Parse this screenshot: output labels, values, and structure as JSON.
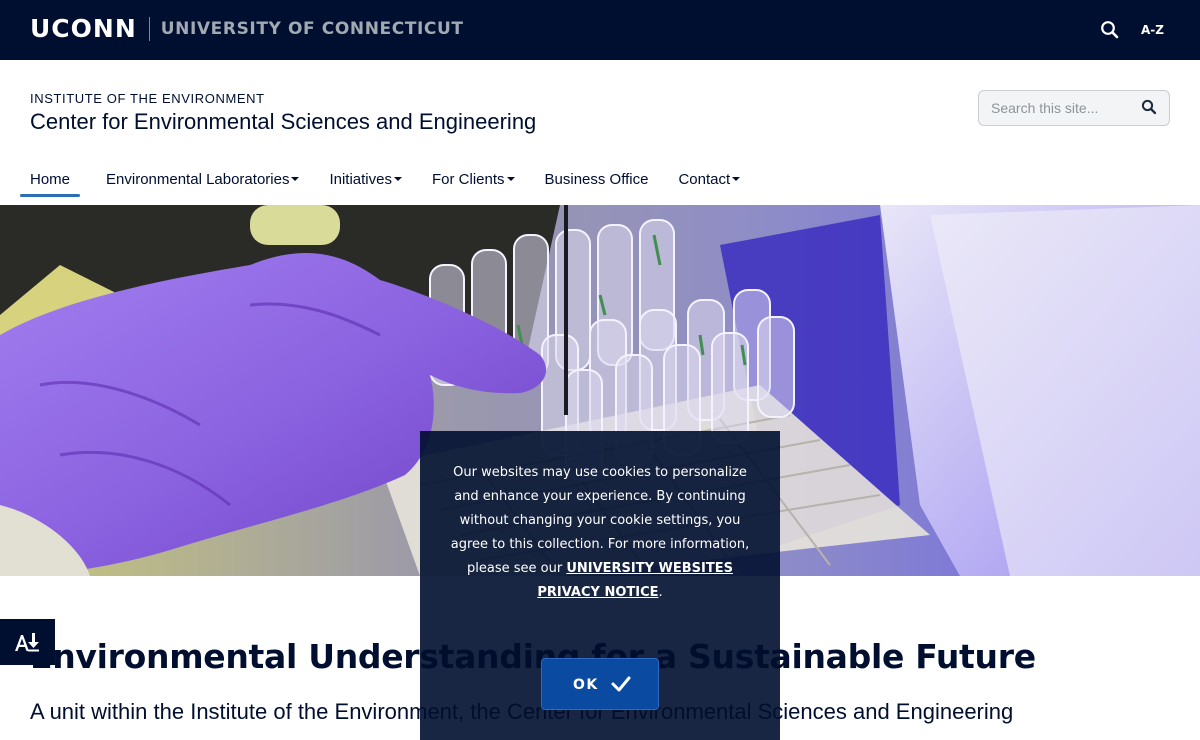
{
  "topbar": {
    "logo": "UCONN",
    "university": "UNIVERSITY OF CONNECTICUT",
    "search_icon": "search-icon",
    "az_label": "A-Z"
  },
  "header": {
    "institute": "INSTITUTE OF THE ENVIRONMENT",
    "title": "Center for Environmental Sciences and Engineering",
    "search_placeholder": "Search this site...",
    "search_icon": "search-icon"
  },
  "nav": {
    "items": [
      {
        "label": "Home",
        "active": true,
        "dropdown": false
      },
      {
        "label": "Environmental Laboratories",
        "active": false,
        "dropdown": true
      },
      {
        "label": "Initiatives",
        "active": false,
        "dropdown": true
      },
      {
        "label": "For Clients",
        "active": false,
        "dropdown": true
      },
      {
        "label": "Business Office",
        "active": false,
        "dropdown": false
      },
      {
        "label": "Contact",
        "active": false,
        "dropdown": true
      }
    ]
  },
  "hero": {
    "icon": "lab-photo"
  },
  "main": {
    "headline": "Environmental Understanding for a Sustainable Future",
    "subheadline": "A unit within the Institute of the Environment, the Center for Environmental Sciences and Engineering"
  },
  "accessibility": {
    "icon": "accessibility-download-icon"
  },
  "cookie": {
    "text": "Our websites may use cookies to personalize and enhance your experience. By continuing without changing your cookie settings, you agree to this collection. For more information, please see our",
    "link_label": "UNIVERSITY WEBSITES PRIVACY NOTICE",
    "period": ".",
    "ok_label": "OK",
    "ok_icon": "check-icon"
  },
  "colors": {
    "navy": "#000e2f",
    "accent_blue": "#0a4aa0",
    "nav_underline": "#2b6fb4"
  }
}
